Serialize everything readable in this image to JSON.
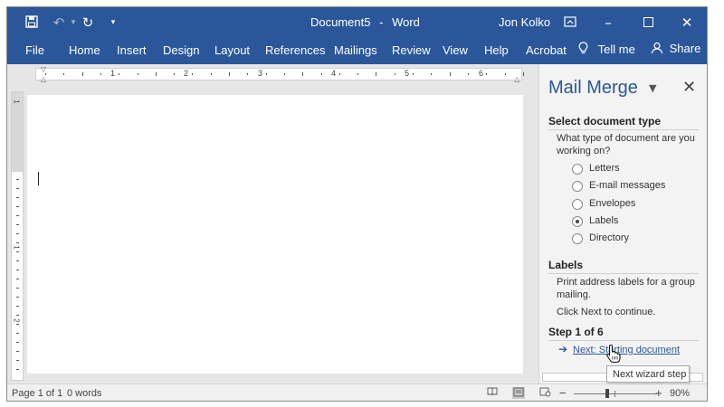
{
  "window": {
    "document_title": "Document5",
    "title_separator": "-",
    "app_name": "Word",
    "user_name": "Jon Kolko",
    "icons": {
      "save": "save-icon",
      "undo": "undo-icon",
      "redo": "redo-icon",
      "customize": "customize-quick-access-icon",
      "ribbon_display": "ribbon-display-options-icon",
      "minimize": "minimize-icon",
      "maximize": "maximize-icon",
      "close": "close-icon"
    }
  },
  "ribbon": {
    "tabs": [
      "File",
      "Home",
      "Insert",
      "Design",
      "Layout",
      "References",
      "Mailings",
      "Review",
      "View",
      "Help",
      "Acrobat"
    ],
    "tell_me": "Tell me",
    "share": "Share"
  },
  "ruler": {
    "numbers": [
      "1",
      "2",
      "3",
      "4",
      "5",
      "6"
    ],
    "vertical_numbers": [
      "1",
      "1",
      "2"
    ]
  },
  "pane": {
    "title": "Mail Merge",
    "select_heading": "Select document type",
    "select_question": "What type of document are you working on?",
    "options": [
      {
        "label": "Letters",
        "selected": false
      },
      {
        "label": "E-mail messages",
        "selected": false
      },
      {
        "label": "Envelopes",
        "selected": false
      },
      {
        "label": "Labels",
        "selected": true
      },
      {
        "label": "Directory",
        "selected": false
      }
    ],
    "labels_heading": "Labels",
    "labels_description": "Print address labels for a group mailing.",
    "continue_text": "Click Next to continue.",
    "step_heading": "Step 1 of 6",
    "next_link": "Next: Starting document",
    "tooltip": "Next wizard step"
  },
  "status": {
    "page": "Page 1 of 1",
    "words": "0 words",
    "zoom_minus": "−",
    "zoom_plus": "+",
    "zoom": "90%"
  },
  "colors": {
    "accent": "#2b579a"
  }
}
